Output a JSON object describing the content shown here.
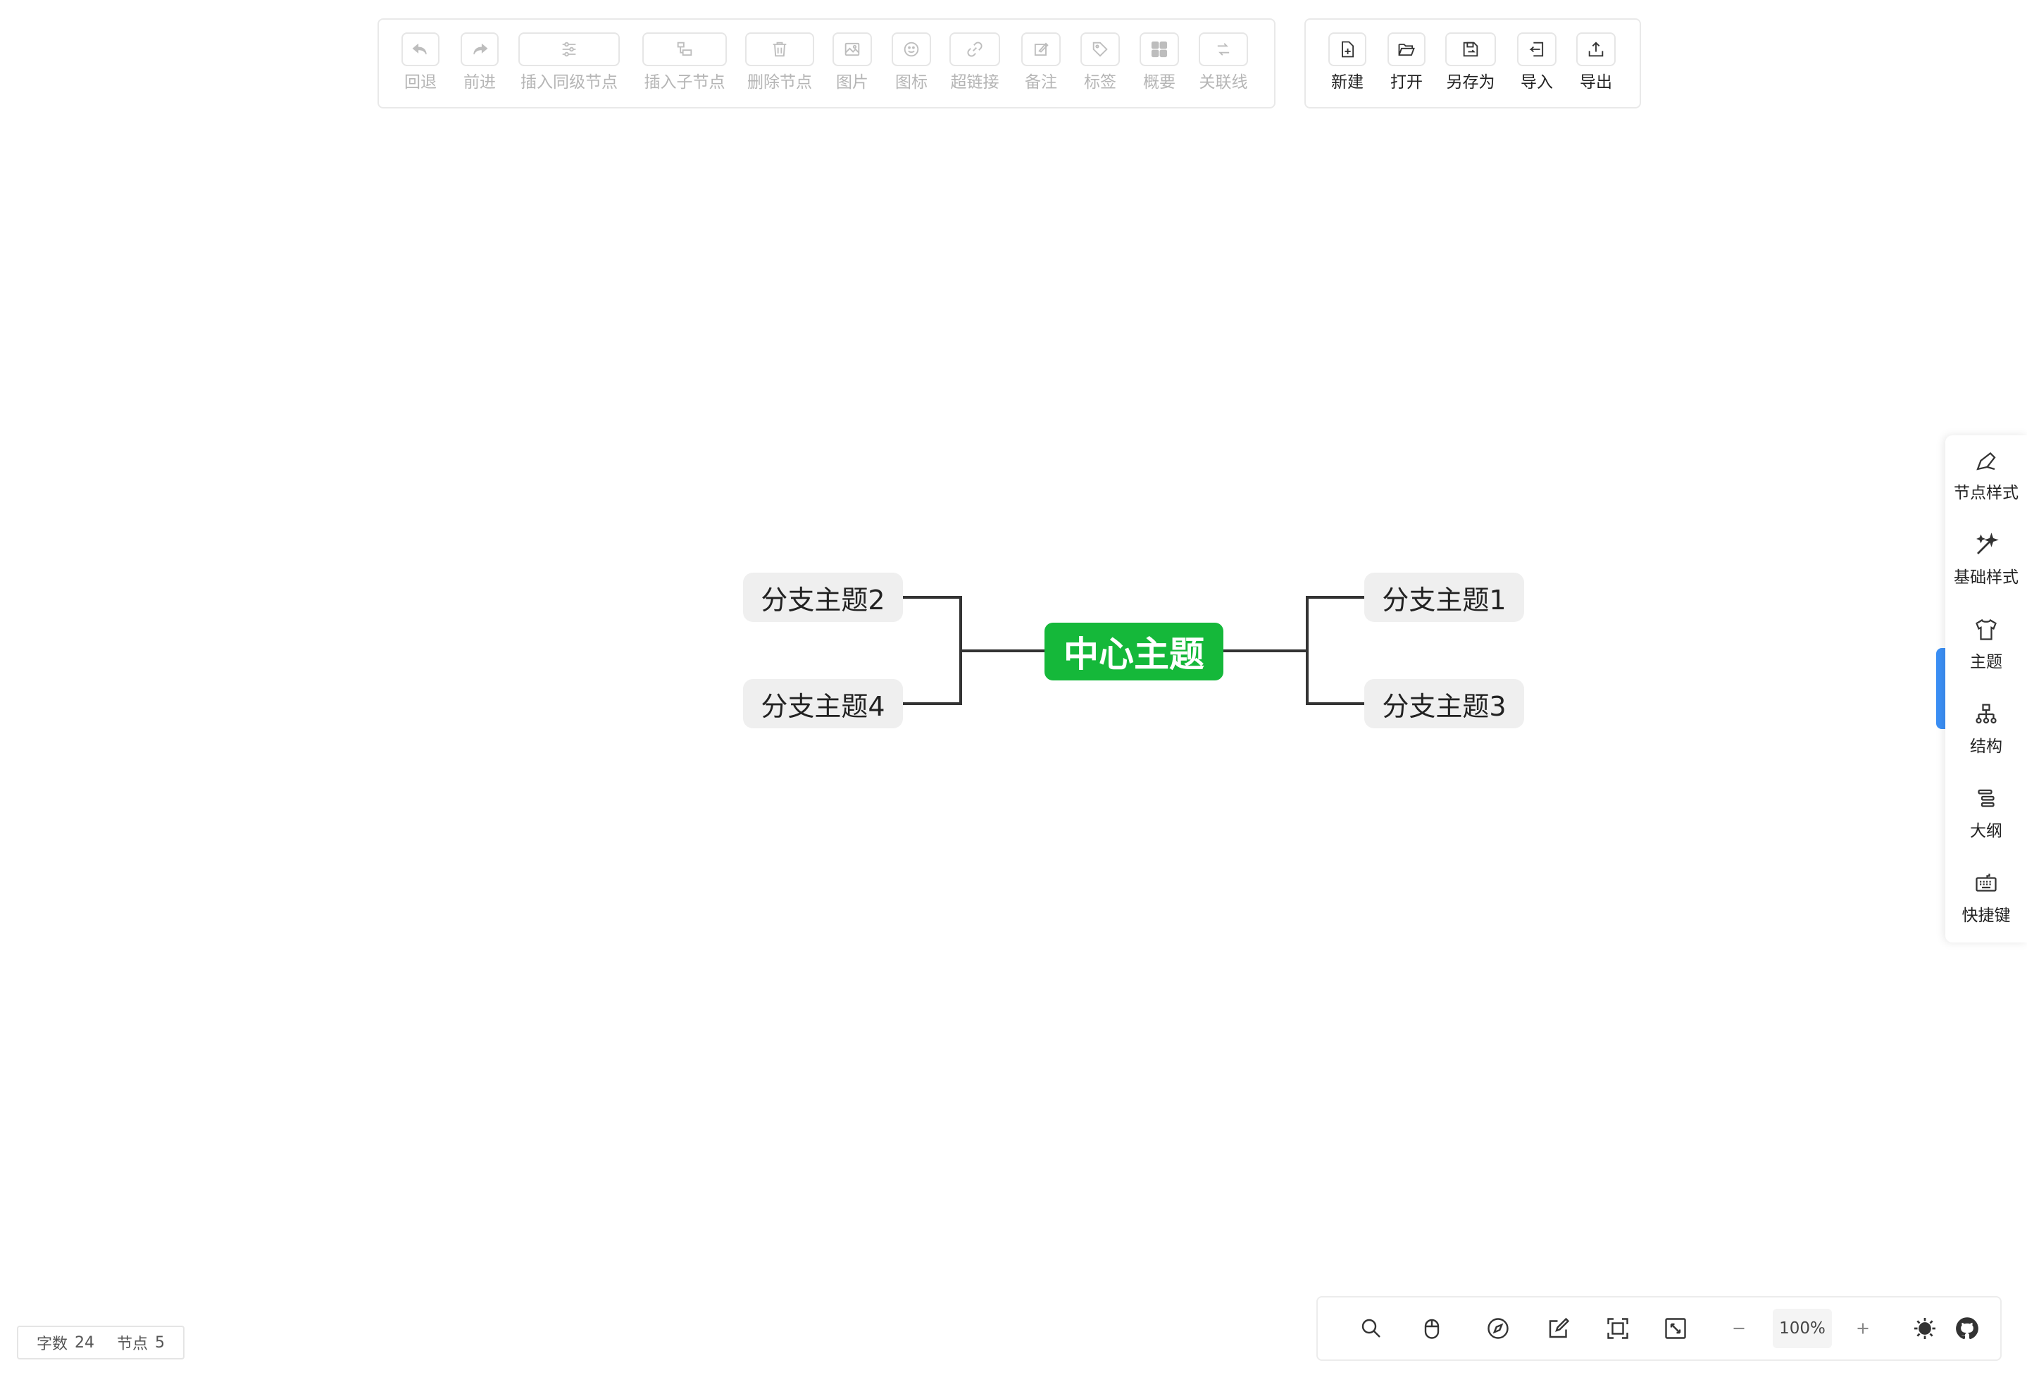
{
  "toolbar": {
    "edit_buttons": [
      {
        "label": "回退",
        "icon": "undo-icon",
        "enabled": false
      },
      {
        "label": "前进",
        "icon": "redo-icon",
        "enabled": false
      },
      {
        "label": "插入同级节点",
        "icon": "sibling-node-icon",
        "enabled": false
      },
      {
        "label": "插入子节点",
        "icon": "child-node-icon",
        "enabled": false
      },
      {
        "label": "删除节点",
        "icon": "trash-icon",
        "enabled": false
      },
      {
        "label": "图片",
        "icon": "image-icon",
        "enabled": false
      },
      {
        "label": "图标",
        "icon": "smiley-icon",
        "enabled": false
      },
      {
        "label": "超链接",
        "icon": "link-icon",
        "enabled": false
      },
      {
        "label": "备注",
        "icon": "note-icon",
        "enabled": false
      },
      {
        "label": "标签",
        "icon": "tag-icon",
        "enabled": false
      },
      {
        "label": "概要",
        "icon": "summary-icon",
        "enabled": false
      },
      {
        "label": "关联线",
        "icon": "association-line-icon",
        "enabled": false
      }
    ],
    "file_buttons": [
      {
        "label": "新建",
        "icon": "new-file-icon"
      },
      {
        "label": "打开",
        "icon": "folder-open-icon"
      },
      {
        "label": "另存为",
        "icon": "save-as-icon"
      },
      {
        "label": "导入",
        "icon": "import-icon"
      },
      {
        "label": "导出",
        "icon": "export-icon"
      }
    ]
  },
  "mindmap": {
    "root": {
      "text": "中心主题",
      "color": "#15b83a"
    },
    "branches": [
      {
        "text": "分支主题1"
      },
      {
        "text": "分支主题2"
      },
      {
        "text": "分支主题3"
      },
      {
        "text": "分支主题4"
      }
    ],
    "line_color": "#333333"
  },
  "sidebar": {
    "items": [
      {
        "label": "节点样式",
        "icon": "node-style-icon"
      },
      {
        "label": "基础样式",
        "icon": "magic-wand-icon"
      },
      {
        "label": "主题",
        "icon": "shirt-icon"
      },
      {
        "label": "结构",
        "icon": "structure-icon"
      },
      {
        "label": "大纲",
        "icon": "outline-icon"
      },
      {
        "label": "快捷键",
        "icon": "keyboard-icon"
      }
    ],
    "active_indicator_color": "#3b8ff5"
  },
  "bottom_bar": {
    "icons": [
      "search-icon",
      "mouse-icon",
      "compass-icon",
      "edit-icon",
      "fit-screen-icon",
      "fullscreen-icon",
      "zoom-out-icon",
      "zoom-in-icon",
      "theme-icon",
      "github-icon"
    ],
    "zoom": "100%"
  },
  "stats": {
    "word_count_label": "字数",
    "word_count": "24",
    "node_count_label": "节点",
    "node_count": "5"
  }
}
